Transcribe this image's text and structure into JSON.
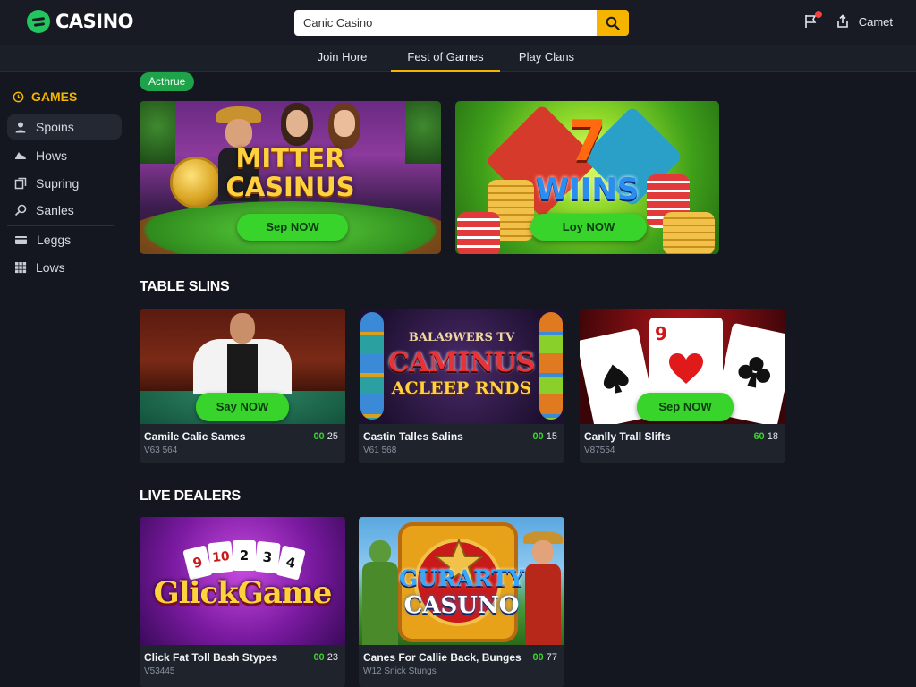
{
  "header": {
    "logo_text": "CASINO",
    "search_value": "Canic Casino",
    "account_label": "Camet"
  },
  "nav": {
    "items": [
      "Join Hore",
      "Fest of Games",
      "Play Clans"
    ],
    "active_index": 1
  },
  "sidebar": {
    "title": "GAMES",
    "items": [
      {
        "label": "Spoins",
        "icon": "user-icon"
      },
      {
        "label": "Hows",
        "icon": "shoe-icon"
      },
      {
        "label": "Supring",
        "icon": "copy-icon"
      },
      {
        "label": "Sanles",
        "icon": "search-icon"
      },
      {
        "label": "Leggs",
        "icon": "card-icon"
      },
      {
        "label": "Lows",
        "icon": "grid-icon"
      }
    ],
    "active_index": 0
  },
  "content": {
    "pill_label": "Acthrue",
    "banners": [
      {
        "title_line1": "MITTER",
        "title_line2": "CASINUS",
        "cta": "Sep NOW"
      },
      {
        "title_big": "7",
        "title_word": "WIINS",
        "cta": "Loy NOW"
      }
    ],
    "table_section_title": "TABLE SLINS",
    "table_cards": [
      {
        "name": "Camile Calic Sames",
        "meta": "V63 564",
        "num_green": "00",
        "num": "25",
        "cta": "Say NOW"
      },
      {
        "name": "Castin Talles Salins",
        "meta": "V61 568",
        "num_green": "00",
        "num": "15",
        "thumb_line1": "BALA9WERS TV",
        "thumb_line2": "CAMINUS",
        "thumb_line3": "ACLEEP RNDS"
      },
      {
        "name": "Canlly Trall Slifts",
        "meta": "V87554",
        "num_green": "60",
        "num": "18",
        "cta": "Sep NOW",
        "card_value": "9"
      }
    ],
    "live_section_title": "LIVE DEALERS",
    "live_cards": [
      {
        "name": "Click Fat Toll Bash Stypes",
        "meta": "V53445",
        "num_green": "00",
        "num": "23",
        "thumb_text": "GlickGame",
        "cards": [
          "9",
          "10",
          "2",
          "3",
          "4"
        ]
      },
      {
        "name": "Canes For Callie Back, Bunges",
        "meta": "W12 Snick Stungs",
        "num_green": "00",
        "num": "77",
        "thumb_line1": "GURARTY",
        "thumb_line2": "CASUNO"
      }
    ]
  },
  "colors": {
    "background": "#14171f",
    "accent_yellow": "#f5b400",
    "accent_green": "#39d42b",
    "brand_green": "#22c55e"
  }
}
